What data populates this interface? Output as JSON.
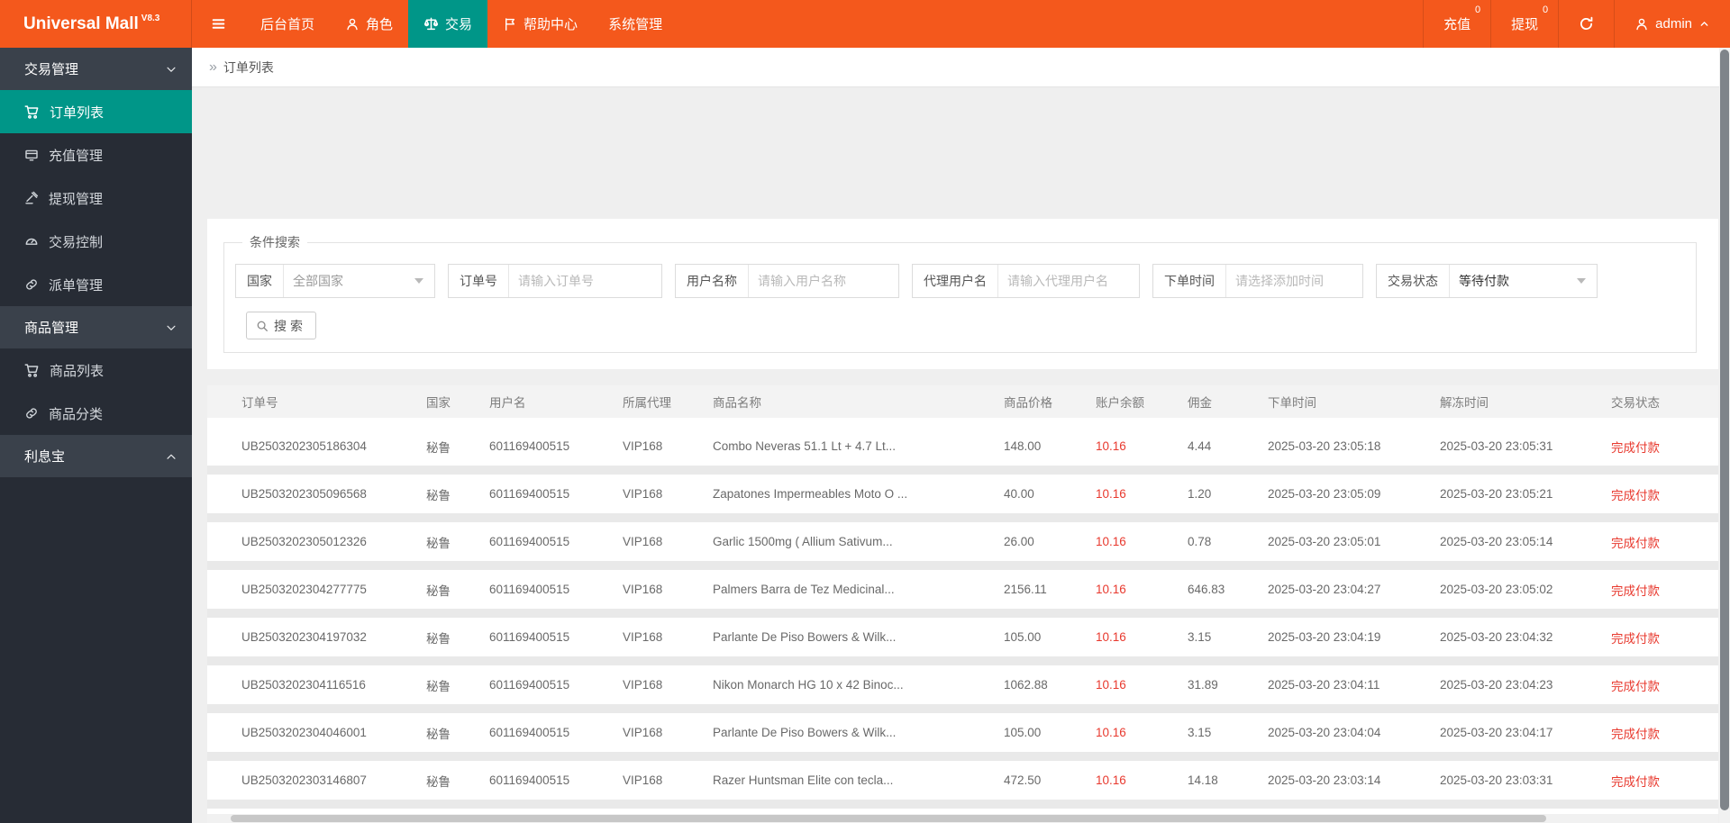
{
  "topbar": {
    "brand": "Universal Mall",
    "version": "V8.3",
    "menu": [
      {
        "key": "home",
        "label": "后台首页",
        "icon": null,
        "active": false
      },
      {
        "key": "roles",
        "label": "角色",
        "icon": "user-icon",
        "active": false
      },
      {
        "key": "trade",
        "label": "交易",
        "icon": "scales-icon",
        "active": true
      },
      {
        "key": "help",
        "label": "帮助中心",
        "icon": "flag-icon",
        "active": false
      },
      {
        "key": "system",
        "label": "系统管理",
        "icon": null,
        "active": false
      }
    ],
    "quick": [
      {
        "key": "recharge",
        "label": "充值",
        "badge": "0"
      },
      {
        "key": "withdraw",
        "label": "提现",
        "badge": "0"
      }
    ],
    "user": {
      "name": "admin"
    }
  },
  "sidebar": {
    "sections": [
      {
        "key": "trade-manage",
        "title": "交易管理",
        "state": "expanded",
        "chevron": "down",
        "items": [
          {
            "key": "order-list",
            "label": "订单列表",
            "icon": "cart-icon",
            "active": true
          },
          {
            "key": "recharge-manage",
            "label": "充值管理",
            "icon": "card-icon",
            "active": false
          },
          {
            "key": "withdraw-manage",
            "label": "提现管理",
            "icon": "gavel-icon",
            "active": false
          },
          {
            "key": "trade-control",
            "label": "交易控制",
            "icon": "gauge-icon",
            "active": false
          },
          {
            "key": "dispatch-manage",
            "label": "派单管理",
            "icon": "link-icon",
            "active": false
          }
        ]
      },
      {
        "key": "goods-manage",
        "title": "商品管理",
        "state": "expanded",
        "chevron": "down",
        "items": [
          {
            "key": "goods-list",
            "label": "商品列表",
            "icon": "cart-icon",
            "active": false
          },
          {
            "key": "goods-category",
            "label": "商品分类",
            "icon": "link-icon",
            "active": false
          }
        ]
      },
      {
        "key": "interest-treasure",
        "title": "利息宝",
        "state": "collapsed",
        "chevron": "up",
        "items": []
      }
    ]
  },
  "breadcrumb": {
    "current": "订单列表"
  },
  "search": {
    "legend": "条件搜索",
    "fields": [
      {
        "key": "country",
        "label": "国家",
        "type": "select",
        "value": "全部国家",
        "muted": true
      },
      {
        "key": "order-no",
        "label": "订单号",
        "type": "input",
        "placeholder": "请输入订单号"
      },
      {
        "key": "username",
        "label": "用户名称",
        "type": "input",
        "placeholder": "请输入用户名称"
      },
      {
        "key": "agent-username",
        "label": "代理用户名",
        "type": "input",
        "placeholder": "请输入代理用户名"
      },
      {
        "key": "order-time",
        "label": "下单时间",
        "type": "input",
        "placeholder": "请选择添加时间"
      },
      {
        "key": "trade-status",
        "label": "交易状态",
        "type": "select",
        "value": "等待付款",
        "muted": false
      }
    ],
    "button_label": "搜索"
  },
  "table": {
    "headers": [
      "订单号",
      "国家",
      "用户名",
      "所属代理",
      "商品名称",
      "商品价格",
      "账户余额",
      "佣金",
      "下单时间",
      "解冻时间",
      "交易状态"
    ],
    "red_columns": [
      6,
      10
    ],
    "rows": [
      [
        "UB2503202305186304",
        "秘鲁",
        "601169400515",
        "VIP168",
        "Combo Neveras 51.1 Lt + 4.7 Lt...",
        "148.00",
        "10.16",
        "4.44",
        "2025-03-20 23:05:18",
        "2025-03-20 23:05:31",
        "完成付款"
      ],
      [
        "UB2503202305096568",
        "秘鲁",
        "601169400515",
        "VIP168",
        "Zapatones Impermeables Moto O ...",
        "40.00",
        "10.16",
        "1.20",
        "2025-03-20 23:05:09",
        "2025-03-20 23:05:21",
        "完成付款"
      ],
      [
        "UB2503202305012326",
        "秘鲁",
        "601169400515",
        "VIP168",
        "Garlic 1500mg ( Allium Sativum...",
        "26.00",
        "10.16",
        "0.78",
        "2025-03-20 23:05:01",
        "2025-03-20 23:05:14",
        "完成付款"
      ],
      [
        "UB2503202304277775",
        "秘鲁",
        "601169400515",
        "VIP168",
        "Palmers Barra de Tez Medicinal...",
        "2156.11",
        "10.16",
        "646.83",
        "2025-03-20 23:04:27",
        "2025-03-20 23:05:02",
        "完成付款"
      ],
      [
        "UB2503202304197032",
        "秘鲁",
        "601169400515",
        "VIP168",
        "Parlante De Piso Bowers & Wilk...",
        "105.00",
        "10.16",
        "3.15",
        "2025-03-20 23:04:19",
        "2025-03-20 23:04:32",
        "完成付款"
      ],
      [
        "UB2503202304116516",
        "秘鲁",
        "601169400515",
        "VIP168",
        "Nikon Monarch HG 10 x 42 Binoc...",
        "1062.88",
        "10.16",
        "31.89",
        "2025-03-20 23:04:11",
        "2025-03-20 23:04:23",
        "完成付款"
      ],
      [
        "UB2503202304046001",
        "秘鲁",
        "601169400515",
        "VIP168",
        "Parlante De Piso Bowers & Wilk...",
        "105.00",
        "10.16",
        "3.15",
        "2025-03-20 23:04:04",
        "2025-03-20 23:04:17",
        "完成付款"
      ],
      [
        "UB2503202303146807",
        "秘鲁",
        "601169400515",
        "VIP168",
        "Razer Huntsman Elite con tecla...",
        "472.50",
        "10.16",
        "14.18",
        "2025-03-20 23:03:14",
        "2025-03-20 23:03:31",
        "完成付款"
      ]
    ]
  },
  "colors": {
    "accent_orange": "#f4581c",
    "accent_teal": "#009688",
    "status_red": "#e8392e"
  }
}
